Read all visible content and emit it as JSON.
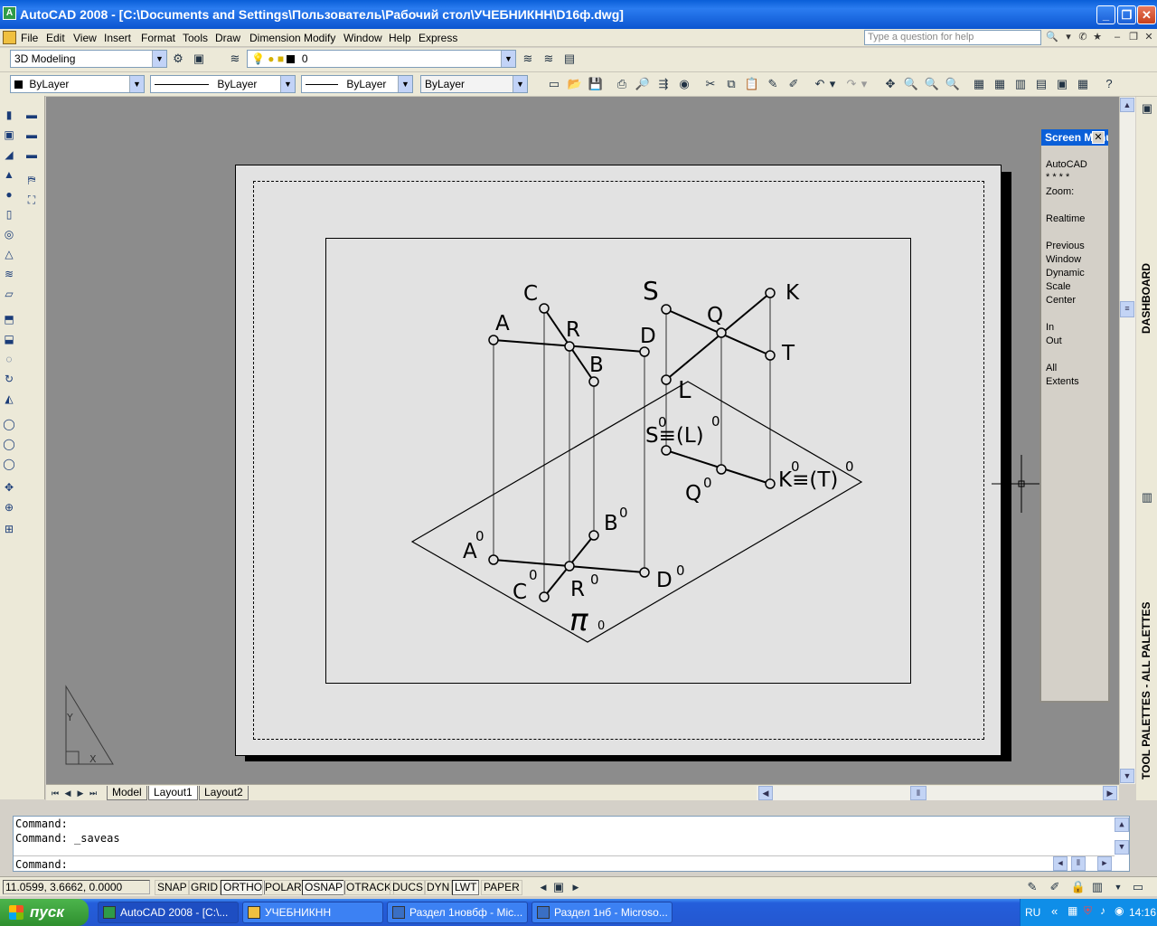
{
  "window": {
    "title": "AutoCAD 2008 - [C:\\Documents and Settings\\Пользователь\\Рабочий стол\\УЧЕБНИКНН\\D16ф.dwg]",
    "minimize": "_",
    "restore": "❐",
    "close": "✕"
  },
  "menu": {
    "items": [
      "File",
      "Edit",
      "View",
      "Insert",
      "Format",
      "Tools",
      "Draw",
      "Dimension",
      "Modify",
      "Window",
      "Help",
      "Express"
    ],
    "help_placeholder": "Type a question for help"
  },
  "toolbar1": {
    "workspace": "3D Modeling",
    "layer": "0"
  },
  "toolbar2": {
    "color": "ByLayer",
    "linetype": "ByLayer",
    "lineweight": "ByLayer",
    "plotstyle": "ByLayer"
  },
  "drawing": {
    "labels": {
      "A": "A",
      "B": "B",
      "C": "C",
      "D": "D",
      "R": "R",
      "S": "S",
      "Q": "Q",
      "K": "K",
      "T": "T",
      "L": "L",
      "A0": "A",
      "B0": "B",
      "C0": "C",
      "D0": "D",
      "R0": "R",
      "Q0": "Q",
      "SL0": "S≡(L)",
      "KT0": "K≡(T)",
      "pi": "π",
      "zero": "0"
    }
  },
  "ucs": {
    "x": "X",
    "y": "Y"
  },
  "screen_menu": {
    "title": "Screen Menu",
    "close": "✕",
    "items": [
      "AutoCAD",
      "* * * *",
      "Zoom:",
      "",
      "Realtime",
      "",
      "Previous",
      "Window",
      "Dynamic",
      "Scale",
      "Center",
      "",
      "In",
      "Out",
      "",
      "All",
      "Extents"
    ]
  },
  "right_palettes": {
    "dashboard": "DASHBOARD",
    "tool_palettes": "TOOL PALETTES - ALL PALETTES"
  },
  "tabs": {
    "model": "Model",
    "layout1": "Layout1",
    "layout2": "Layout2"
  },
  "command": {
    "line1": "Command:",
    "line2": "Command: _saveas",
    "prompt": "Command:"
  },
  "status": {
    "coords": "11.0599, 3.6662, 0.0000",
    "buttons": [
      "SNAP",
      "GRID",
      "ORTHO",
      "POLAR",
      "OSNAP",
      "OTRACK",
      "DUCS",
      "DYN",
      "LWT",
      "PAPER"
    ]
  },
  "taskbar": {
    "start": "пуск",
    "tasks": [
      "AutoCAD 2008 - [C:\\...",
      "УЧЕБНИКНН",
      "Раздел 1новбф - Mic...",
      "Раздел 1нб - Microso..."
    ],
    "lang": "RU",
    "time": "14:16"
  }
}
